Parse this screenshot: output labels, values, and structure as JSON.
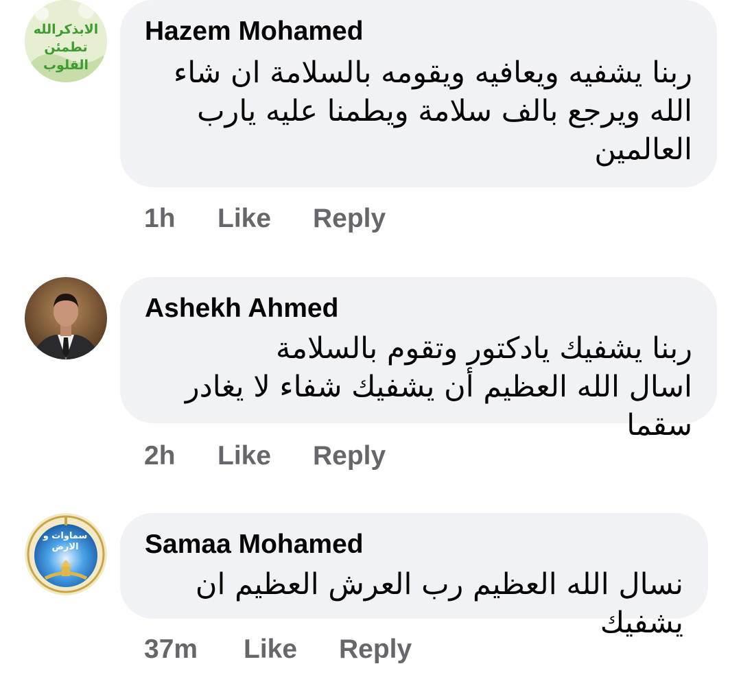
{
  "comments": [
    {
      "author": "Hazem Mohamed",
      "text": "ربنا يشفيه ويعافيه ويقومه بالسلامة ان شاء\nالله ويرجع بالف سلامة ويطمنا عليه يارب\nالعالمين",
      "time": "1h",
      "like_label": "Like",
      "reply_label": "Reply",
      "avatar_text": "الابذكرالله\nتطمئن القلوب",
      "avatar_icon": "text-badge-avatar-icon"
    },
    {
      "author": "Ashekh Ahmed",
      "text": "ربنا يشفيك يادكتور وتقوم بالسلامة\nاسال الله العظيم أن يشفيك شفاء لا يغادر سقما",
      "time": "2h",
      "like_label": "Like",
      "reply_label": "Reply",
      "avatar_icon": "person-photo-icon"
    },
    {
      "author": "Samaa Mohamed",
      "text": "نسال الله العظيم رب العرش العظيم ان يشفيك",
      "time": "37m",
      "like_label": "Like",
      "reply_label": "Reply",
      "avatar_text": "سماوات و الارض",
      "avatar_icon": "sky-emblem-icon"
    }
  ],
  "colors": {
    "bubble": "#f0f2f5",
    "text": "#050505",
    "meta": "#65676b"
  }
}
